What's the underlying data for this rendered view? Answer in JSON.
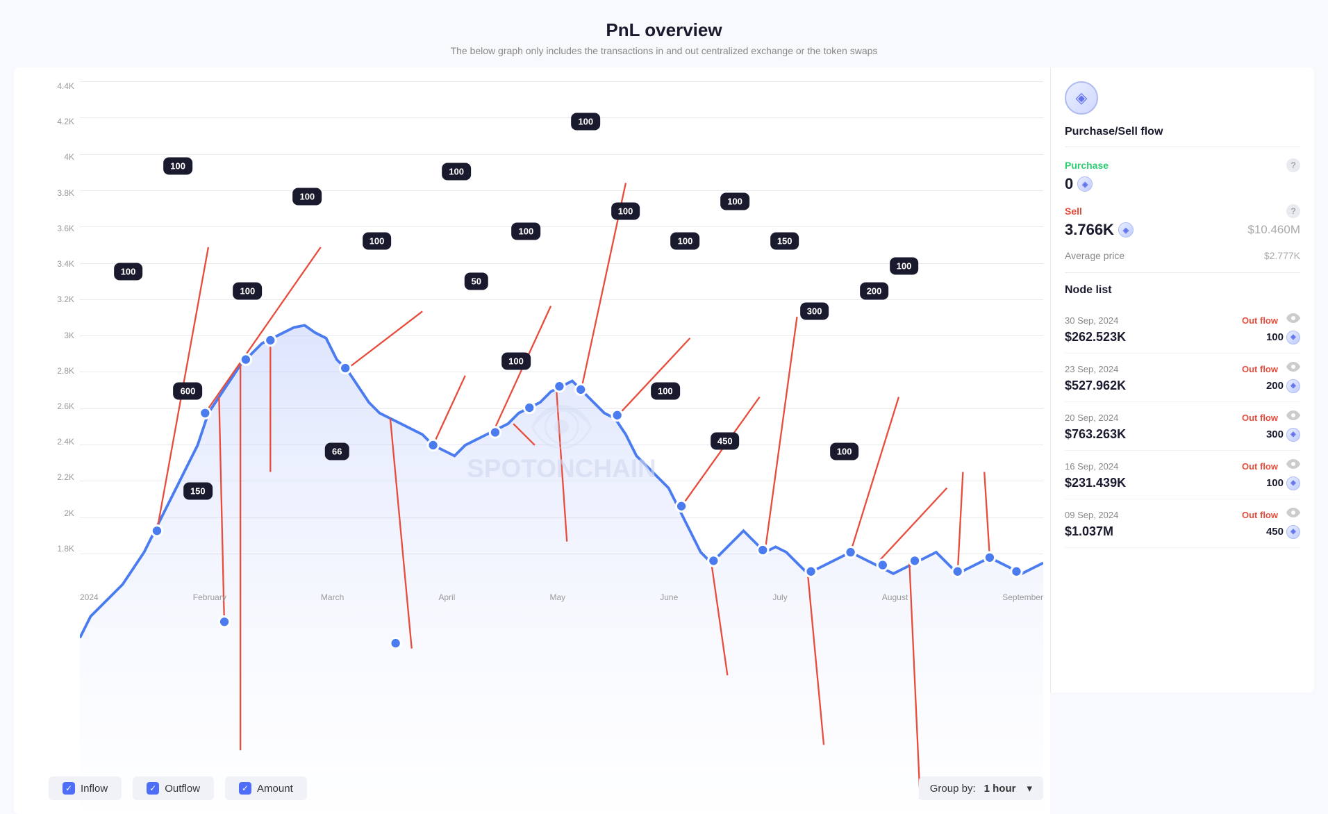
{
  "header": {
    "title": "PnL overview",
    "subtitle": "The below graph only includes the transactions in and out centralized exchange or the token swaps"
  },
  "chart": {
    "yAxis": [
      "4.4K",
      "4.2K",
      "4K",
      "3.8K",
      "3.6K",
      "3.4K",
      "3.2K",
      "3K",
      "2.8K",
      "2.6K",
      "2.4K",
      "2.2K",
      "2K",
      "1.8K"
    ],
    "xAxis": [
      "2024",
      "February",
      "March",
      "April",
      "May",
      "June",
      "July",
      "August",
      "September"
    ],
    "dataLabels": [
      {
        "value": "100",
        "left": "8%",
        "top": "38%"
      },
      {
        "value": "100",
        "left": "13%",
        "top": "17%"
      },
      {
        "value": "600",
        "left": "14%",
        "top": "47%"
      },
      {
        "value": "150",
        "left": "15%",
        "top": "74%"
      },
      {
        "value": "100",
        "left": "20%",
        "top": "32%"
      },
      {
        "value": "100",
        "left": "25%",
        "top": "20%"
      },
      {
        "value": "66",
        "left": "28%",
        "top": "71%"
      },
      {
        "value": "100",
        "left": "32%",
        "top": "27%"
      },
      {
        "value": "100",
        "left": "36%",
        "top": "16%"
      },
      {
        "value": "50",
        "left": "40%",
        "top": "36%"
      },
      {
        "value": "100",
        "left": "43%",
        "top": "26%"
      },
      {
        "value": "100",
        "left": "46%",
        "top": "58%"
      },
      {
        "value": "100",
        "left": "52%",
        "top": "10%"
      },
      {
        "value": "100",
        "left": "56%",
        "top": "24%"
      },
      {
        "value": "100",
        "left": "60%",
        "top": "30%"
      },
      {
        "value": "100",
        "left": "62%",
        "top": "58%"
      },
      {
        "value": "100",
        "left": "65%",
        "top": "24%"
      },
      {
        "value": "150",
        "left": "70%",
        "top": "30%"
      },
      {
        "value": "450",
        "left": "67%",
        "top": "70%"
      },
      {
        "value": "300",
        "left": "75%",
        "top": "46%"
      },
      {
        "value": "200",
        "left": "81%",
        "top": "41%"
      },
      {
        "value": "100",
        "left": "78%",
        "top": "72%"
      },
      {
        "value": "100",
        "left": "85%",
        "top": "36%"
      }
    ]
  },
  "controls": {
    "inflow": {
      "label": "Inflow",
      "checked": true
    },
    "outflow": {
      "label": "Outflow",
      "checked": true
    },
    "amount": {
      "label": "Amount",
      "checked": true
    },
    "groupBy": {
      "label": "Group by:",
      "value": "1 hour"
    }
  },
  "rightPanel": {
    "ethIcon": "◈",
    "purchaseSellFlow": {
      "title": "Purchase/Sell flow",
      "purchase": {
        "label": "Purchase",
        "amount": "0",
        "usd": ""
      },
      "sell": {
        "label": "Sell",
        "amount": "3.766K",
        "usd": "$10.460M",
        "avgPriceLabel": "Average price",
        "avgPriceValue": "$2.777K"
      }
    },
    "nodeList": {
      "title": "Node list",
      "items": [
        {
          "date": "30 Sep, 2024",
          "flowType": "Out flow",
          "amount": "$262.523K",
          "ethAmount": "100"
        },
        {
          "date": "23 Sep, 2024",
          "flowType": "Out flow",
          "amount": "$527.962K",
          "ethAmount": "200"
        },
        {
          "date": "20 Sep, 2024",
          "flowType": "Out flow",
          "amount": "$763.263K",
          "ethAmount": "300"
        },
        {
          "date": "16 Sep, 2024",
          "flowType": "Out flow",
          "amount": "$231.439K",
          "ethAmount": "100"
        },
        {
          "date": "09 Sep, 2024",
          "flowType": "Out flow",
          "amount": "$1.037M",
          "ethAmount": "450"
        }
      ]
    }
  }
}
